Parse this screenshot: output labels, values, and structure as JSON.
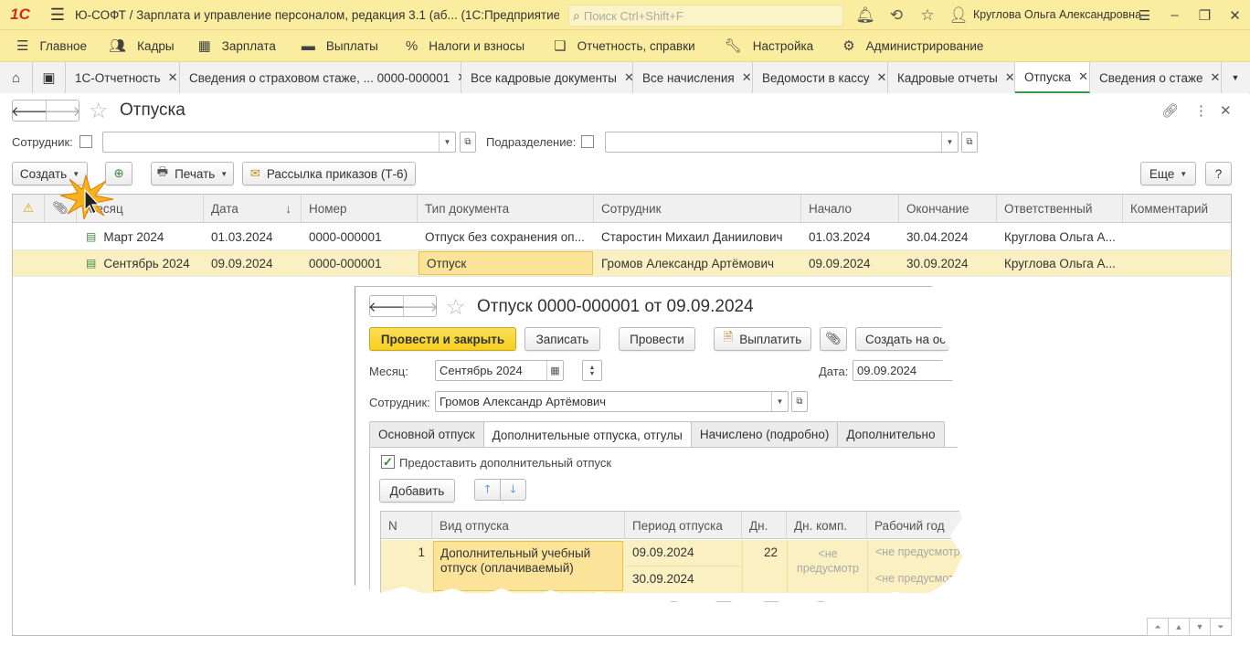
{
  "app": {
    "logo": "1С",
    "title": "Ю-СОФТ / Зарплата и управление персоналом, редакция 3.1 (аб...   (1С:Предприятие)",
    "search_placeholder": "Поиск Ctrl+Shift+F",
    "user": "Круглова Ольга Александровна"
  },
  "main_menu": [
    {
      "label": "Главное",
      "icon": "menu-icon"
    },
    {
      "label": "Кадры",
      "icon": "people-icon"
    },
    {
      "label": "Зарплата",
      "icon": "calculator-icon"
    },
    {
      "label": "Выплаты",
      "icon": "wallet-icon"
    },
    {
      "label": "Налоги и взносы",
      "icon": "percent-icon"
    },
    {
      "label": "Отчетность, справки",
      "icon": "reports-icon"
    },
    {
      "label": "Настройка",
      "icon": "wrench-icon"
    },
    {
      "label": "Администрирование",
      "icon": "gear-icon"
    }
  ],
  "tabs": [
    {
      "label": "1С-Отчетность"
    },
    {
      "label": "Сведения о страховом стаже, ... 0000-000001"
    },
    {
      "label": "Все кадровые документы"
    },
    {
      "label": "Все начисления"
    },
    {
      "label": "Ведомости в кассу"
    },
    {
      "label": "Кадровые отчеты"
    },
    {
      "label": "Отпуска",
      "active": true
    },
    {
      "label": "Сведения о стаже"
    }
  ],
  "form": {
    "title": "Отпуска",
    "filter_employee_label": "Сотрудник:",
    "filter_dept_label": "Подразделение:",
    "create_button": "Создать",
    "print_button": "Печать",
    "mailing_button": "Рассылка приказов (Т-6)",
    "more_button": "Еще",
    "help_button": "?"
  },
  "table": {
    "columns": [
      "Месяц",
      "Дата",
      "Номер",
      "Тип документа",
      "Сотрудник",
      "Начало",
      "Окончание",
      "Ответственный",
      "Комментарий"
    ],
    "sort_indicator": "↓",
    "rows": [
      {
        "month": "Март 2024",
        "date": "01.03.2024",
        "number": "0000-000001",
        "type": "Отпуск без сохранения оп...",
        "employee": "Старостин Михаил Даниилович",
        "start": "01.03.2024",
        "end": "30.04.2024",
        "responsible": "Круглова Ольга А...",
        "comment": ""
      },
      {
        "month": "Сентябрь 2024",
        "date": "09.09.2024",
        "number": "0000-000001",
        "type": "Отпуск",
        "employee": "Громов Александр Артёмович",
        "start": "09.09.2024",
        "end": "30.09.2024",
        "responsible": "Круглова Ольга А...",
        "comment": "",
        "selected": true
      }
    ]
  },
  "popup": {
    "title": "Отпуск 0000-000001 от 09.09.2024",
    "btn_post_close": "Провести и закрыть",
    "btn_save": "Записать",
    "btn_post": "Провести",
    "btn_pay": "Выплатить",
    "btn_create_based": "Создать на основ",
    "month_label": "Месяц:",
    "month_value": "Сентябрь 2024",
    "date_label": "Дата:",
    "date_value": "09.09.2024",
    "employee_label": "Сотрудник:",
    "employee_value": "Громов Александр Артёмович",
    "tabs": [
      "Основной отпуск",
      "Дополнительные отпуска, отгулы",
      "Начислено (подробно)",
      "Дополнительно"
    ],
    "checkbox_label": "Предоставить дополнительный отпуск",
    "add_button": "Добавить",
    "columns": [
      "N",
      "Вид отпуска",
      "Период отпуска",
      "Дн.",
      "Дн. комп.",
      "Рабочий год"
    ],
    "row": {
      "n": "1",
      "kind_line1": "Дополнительный учебный",
      "kind_line2": "отпуск (оплачиваемый)",
      "period_from": "09.09.2024",
      "period_to": "30.09.2024",
      "days": "22",
      "comp_line1": "<не",
      "comp_line2": "предусмотр",
      "work_year_1": "<не предусмотр",
      "work_year_2": "<не предусмотр"
    }
  }
}
